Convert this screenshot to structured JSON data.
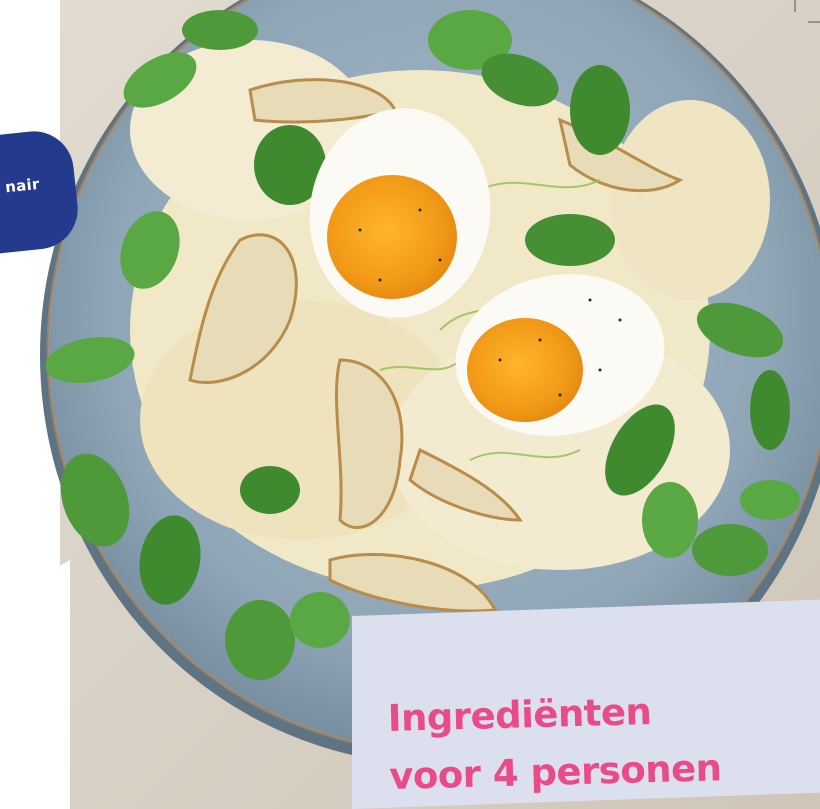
{
  "badge": {
    "text": "nair"
  },
  "ingredients": {
    "line1": "Ingrediënten",
    "line2": "voor 4 personen"
  },
  "colors": {
    "badge_bg": "#243a8c",
    "panel_bg": "#dcdfee",
    "title_pink": "#e94b8a",
    "plate": "#8fa7b8"
  }
}
